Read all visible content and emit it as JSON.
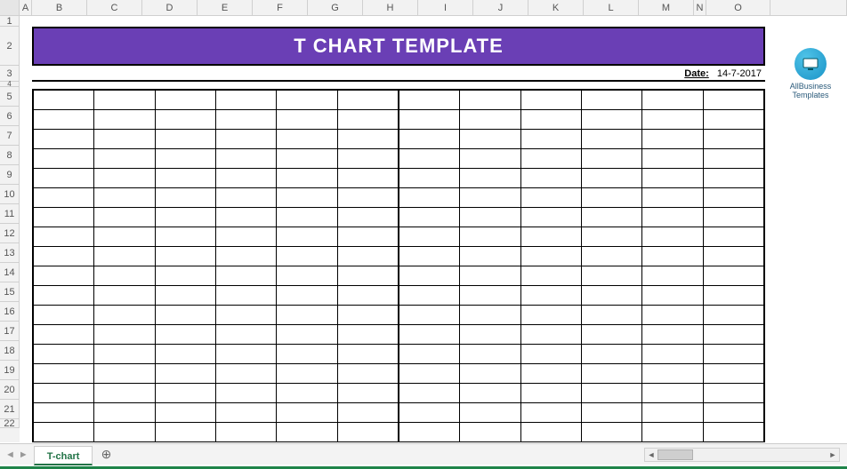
{
  "columns": [
    "A",
    "B",
    "C",
    "D",
    "E",
    "F",
    "G",
    "H",
    "I",
    "J",
    "K",
    "L",
    "M",
    "N",
    "O"
  ],
  "rows": [
    "1",
    "2",
    "3",
    "4",
    "5",
    "6",
    "7",
    "8",
    "9",
    "10",
    "11",
    "12",
    "13",
    "14",
    "15",
    "16",
    "17",
    "18",
    "19",
    "20",
    "21",
    "22"
  ],
  "banner": {
    "title": "T CHART TEMPLATE"
  },
  "date": {
    "label": "Date:",
    "value": "14-7-2017"
  },
  "logo": {
    "line1": "AllBusiness",
    "line2": "Templates"
  },
  "tchart": {
    "num_columns": 12,
    "num_rows": 18,
    "middle_after_col": 6
  },
  "tabs": {
    "active": "T-chart",
    "new_tab_label": "+"
  },
  "scroll": {
    "left_arrow": "◄",
    "right_arrow": "►"
  }
}
